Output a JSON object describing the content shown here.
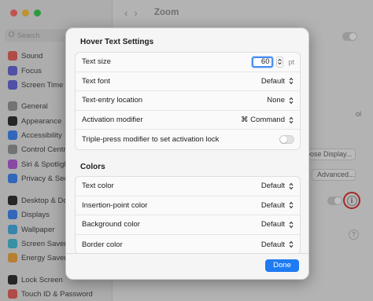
{
  "window": {
    "title": "Zoom",
    "search_placeholder": "Search",
    "sidebar": [
      {
        "label": "Sound",
        "icon": "sound-icon",
        "color": "#e8544e"
      },
      {
        "label": "Focus",
        "icon": "focus-icon",
        "color": "#5a5ad6"
      },
      {
        "label": "Screen Time",
        "icon": "screen-time-icon",
        "color": "#5a5ad6"
      },
      {
        "label": "General",
        "icon": "gear-icon",
        "color": "#8e8e93"
      },
      {
        "label": "Appearance",
        "icon": "appearance-icon",
        "color": "#1d1d1f"
      },
      {
        "label": "Accessibility",
        "icon": "accessibility-icon",
        "color": "#2f7cf6"
      },
      {
        "label": "Control Centre",
        "icon": "control-centre-icon",
        "color": "#8e8e93"
      },
      {
        "label": "Siri & Spotlight",
        "icon": "siri-icon",
        "color": "#b04fd6"
      },
      {
        "label": "Privacy & Security",
        "icon": "hand-icon",
        "color": "#2f7cf6"
      },
      {
        "label": "Desktop & Dock",
        "icon": "dock-icon",
        "color": "#1d1d1f"
      },
      {
        "label": "Displays",
        "icon": "display-icon",
        "color": "#2f7cf6"
      },
      {
        "label": "Wallpaper",
        "icon": "wallpaper-icon",
        "color": "#35a8e0"
      },
      {
        "label": "Screen Saver",
        "icon": "screen-saver-icon",
        "color": "#35b8d8"
      },
      {
        "label": "Energy Saver",
        "icon": "energy-icon",
        "color": "#f0a030"
      },
      {
        "label": "Lock Screen",
        "icon": "lock-icon",
        "color": "#1d1d1f"
      },
      {
        "label": "Touch ID & Password",
        "icon": "fingerprint-icon",
        "color": "#e8544e"
      }
    ],
    "bg_text_ol": "ol",
    "bg_choose_display": "oose Display...",
    "bg_advanced": "Advanced...",
    "info_glyph": "i",
    "help_glyph": "?"
  },
  "sheet": {
    "hover_title": "Hover Text Settings",
    "text_size_label": "Text size",
    "text_size_value": "60",
    "text_size_unit": "pt",
    "text_font_label": "Text font",
    "text_font_value": "Default",
    "entry_location_label": "Text-entry location",
    "entry_location_value": "None",
    "activation_label": "Activation modifier",
    "activation_value": "⌘ Command",
    "triple_press_label": "Triple-press modifier to set activation lock",
    "triple_press_on": false,
    "colors_title": "Colors",
    "text_color_label": "Text color",
    "text_color_value": "Default",
    "insertion_label": "Insertion-point color",
    "insertion_value": "Default",
    "background_label": "Background color",
    "background_value": "Default",
    "border_label": "Border color",
    "border_value": "Default",
    "done_label": "Done",
    "accent": "#1f7bf2"
  }
}
